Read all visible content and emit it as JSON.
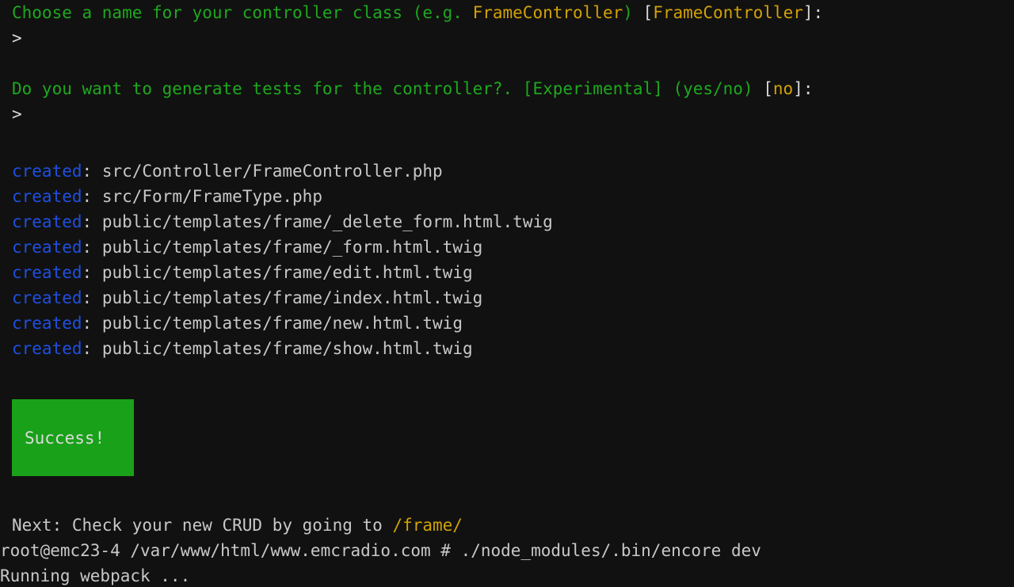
{
  "terminal": {
    "background_color": "#111111",
    "foreground_color": "#d0d0d0",
    "colors": {
      "green": "#1ea81e",
      "gold": "#d2a106",
      "blue": "#1f4fe0",
      "white": "#d8d8d8",
      "success_bg": "#19a119"
    }
  },
  "prompts": {
    "question1": {
      "text_before": "Choose a name for your controller class (e.g. ",
      "example_value": "FrameController",
      "paren_close": ")",
      "bracket_open": " [",
      "default_value": "FrameController",
      "bracket_close": "]:",
      "input_marker": ">"
    },
    "question2": {
      "text_before": "Do you want to generate tests for the controller?. [Experimental] (yes/no)",
      "bracket_open": " [",
      "default_value": "no",
      "bracket_close": "]:",
      "input_marker": ">"
    }
  },
  "created_files": {
    "label": "created",
    "separator": ": ",
    "items": [
      "src/Controller/FrameController.php",
      "src/Form/FrameType.php",
      "public/templates/frame/_delete_form.html.twig",
      "public/templates/frame/_form.html.twig",
      "public/templates/frame/edit.html.twig",
      "public/templates/frame/index.html.twig",
      "public/templates/frame/new.html.twig",
      "public/templates/frame/show.html.twig"
    ]
  },
  "success_banner": {
    "text": "Success!"
  },
  "next_step": {
    "prefix": "Next: Check your new CRUD by going to ",
    "url": "/frame/"
  },
  "shell": {
    "prompt": "root@emc23-4 /var/www/html/www.emcradio.com # ",
    "command": "./node_modules/.bin/encore dev",
    "output": "Running webpack ..."
  }
}
